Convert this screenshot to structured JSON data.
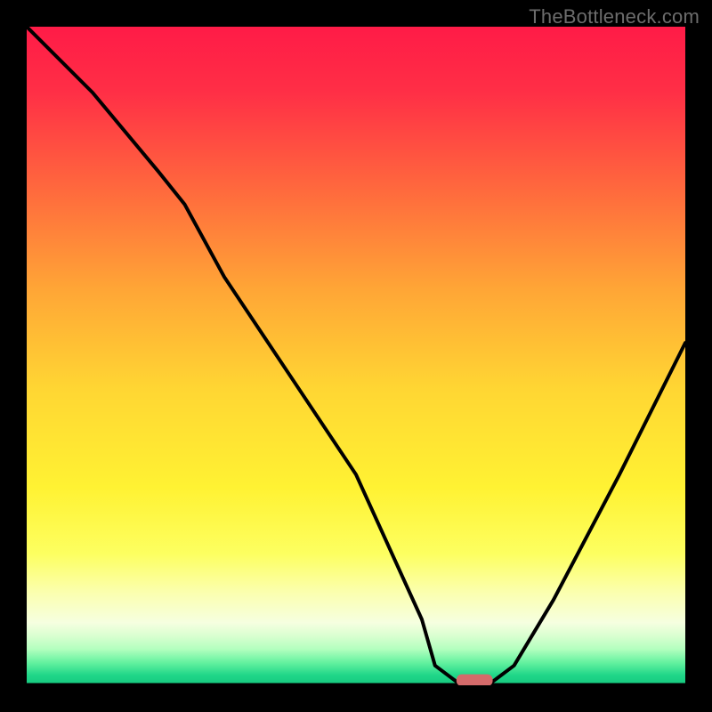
{
  "watermark": "TheBottleneck.com",
  "chart_data": {
    "type": "line",
    "title": "",
    "xlabel": "",
    "ylabel": "",
    "xlim": [
      0,
      100
    ],
    "ylim": [
      0,
      100
    ],
    "series": [
      {
        "name": "curve",
        "x": [
          0,
          10,
          20,
          24,
          30,
          40,
          50,
          60,
          62,
          66,
          70,
          74,
          80,
          90,
          100
        ],
        "y": [
          100,
          90,
          78,
          73,
          62,
          47,
          32,
          10,
          3,
          0,
          0,
          3,
          13,
          32,
          52
        ]
      }
    ],
    "marker": {
      "x": 68,
      "y": 0.3,
      "w": 5.5,
      "h": 1.8
    },
    "background": {
      "stops": [
        {
          "offset": 0.0,
          "color": "#ff1b47"
        },
        {
          "offset": 0.1,
          "color": "#ff2f46"
        },
        {
          "offset": 0.25,
          "color": "#ff6a3d"
        },
        {
          "offset": 0.4,
          "color": "#ffa636"
        },
        {
          "offset": 0.55,
          "color": "#ffd633"
        },
        {
          "offset": 0.7,
          "color": "#fff233"
        },
        {
          "offset": 0.8,
          "color": "#fdff60"
        },
        {
          "offset": 0.86,
          "color": "#fbffb0"
        },
        {
          "offset": 0.905,
          "color": "#f6ffe0"
        },
        {
          "offset": 0.925,
          "color": "#d9ffd0"
        },
        {
          "offset": 0.945,
          "color": "#b3ffbf"
        },
        {
          "offset": 0.965,
          "color": "#66f2a0"
        },
        {
          "offset": 0.985,
          "color": "#1fd688"
        },
        {
          "offset": 1.0,
          "color": "#16c97f"
        }
      ]
    },
    "colors": {
      "curve": "#000000",
      "marker": "#d46a6a",
      "baseline": "#000000"
    }
  }
}
